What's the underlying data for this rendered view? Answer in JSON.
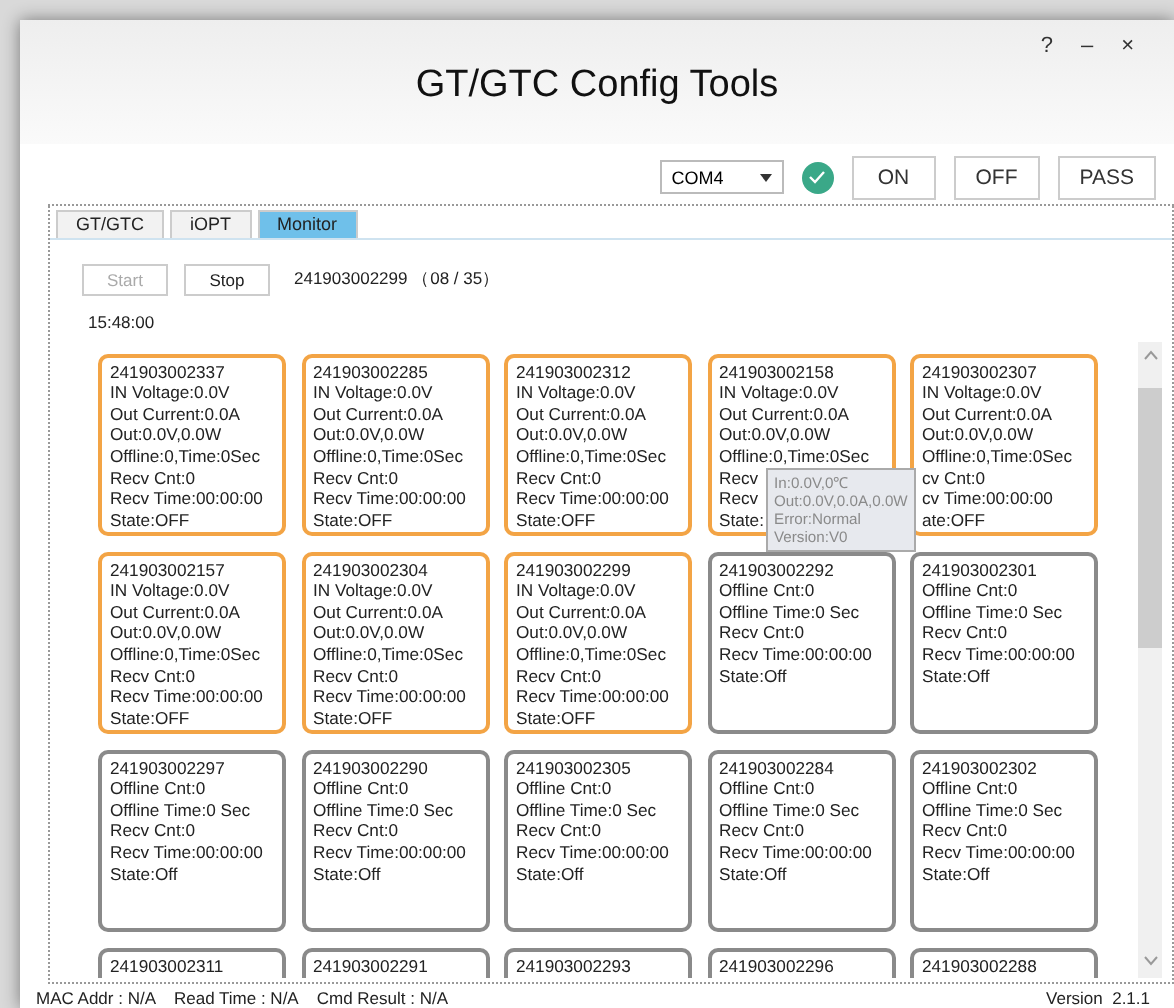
{
  "window": {
    "title": "GT/GTC Config Tools",
    "controls": [
      "?",
      "–",
      "×"
    ]
  },
  "toolbar": {
    "port": "COM4",
    "connected": true,
    "buttons": [
      "ON",
      "OFF",
      "PASS"
    ]
  },
  "tabs": [
    {
      "label": "GT/GTC",
      "selected": false
    },
    {
      "label": "iOPT",
      "selected": false
    },
    {
      "label": "Monitor",
      "selected": true
    }
  ],
  "monitor": {
    "start": {
      "label": "Start",
      "disabled": true
    },
    "stop": {
      "label": "Stop",
      "disabled": false
    },
    "progress": "241903002299 （08 / 35）",
    "time": "15:48:00"
  },
  "cards": [
    {
      "kind": "online",
      "lines": [
        "241903002337",
        "IN Voltage:0.0V",
        "Out Current:0.0A",
        "Out:0.0V,0.0W",
        "Offline:0,Time:0Sec",
        "Recv Cnt:0",
        "Recv Time:00:00:00",
        "State:OFF"
      ]
    },
    {
      "kind": "online",
      "lines": [
        "241903002285",
        "IN Voltage:0.0V",
        "Out Current:0.0A",
        "Out:0.0V,0.0W",
        "Offline:0,Time:0Sec",
        "Recv Cnt:0",
        "Recv Time:00:00:00",
        "State:OFF"
      ]
    },
    {
      "kind": "online",
      "lines": [
        "241903002312",
        "IN Voltage:0.0V",
        "Out Current:0.0A",
        "Out:0.0V,0.0W",
        "Offline:0,Time:0Sec",
        "Recv Cnt:0",
        "Recv Time:00:00:00",
        "State:OFF"
      ]
    },
    {
      "kind": "online",
      "lines": [
        "241903002158",
        "IN Voltage:0.0V",
        "Out Current:0.0A",
        "Out:0.0V,0.0W",
        "Offline:0,Time:0Sec",
        "Recv",
        "Recv",
        "State:"
      ]
    },
    {
      "kind": "online",
      "lines": [
        "241903002307",
        "IN Voltage:0.0V",
        "Out Current:0.0A",
        "Out:0.0V,0.0W",
        "Offline:0,Time:0Sec",
        "cv Cnt:0",
        "cv Time:00:00:00",
        "ate:OFF"
      ]
    },
    {
      "kind": "online",
      "lines": [
        "241903002157",
        "IN Voltage:0.0V",
        "Out Current:0.0A",
        "Out:0.0V,0.0W",
        "Offline:0,Time:0Sec",
        "Recv Cnt:0",
        "Recv Time:00:00:00",
        "State:OFF"
      ]
    },
    {
      "kind": "online",
      "lines": [
        "241903002304",
        "IN Voltage:0.0V",
        "Out Current:0.0A",
        "Out:0.0V,0.0W",
        "Offline:0,Time:0Sec",
        "Recv Cnt:0",
        "Recv Time:00:00:00",
        "State:OFF"
      ]
    },
    {
      "kind": "online",
      "lines": [
        "241903002299",
        "IN Voltage:0.0V",
        "Out Current:0.0A",
        "Out:0.0V,0.0W",
        "Offline:0,Time:0Sec",
        "Recv Cnt:0",
        "Recv Time:00:00:00",
        "State:OFF"
      ]
    },
    {
      "kind": "offline",
      "lines": [
        "241903002292",
        "Offline Cnt:0",
        "Offline Time:0 Sec",
        "Recv Cnt:0",
        "Recv Time:00:00:00",
        "State:Off"
      ]
    },
    {
      "kind": "offline",
      "lines": [
        "241903002301",
        "Offline Cnt:0",
        "Offline Time:0 Sec",
        "Recv Cnt:0",
        "Recv Time:00:00:00",
        "State:Off"
      ]
    },
    {
      "kind": "offline",
      "lines": [
        "241903002297",
        "Offline Cnt:0",
        "Offline Time:0 Sec",
        "Recv Cnt:0",
        "Recv Time:00:00:00",
        "State:Off"
      ]
    },
    {
      "kind": "offline",
      "lines": [
        "241903002290",
        "Offline Cnt:0",
        "Offline Time:0 Sec",
        "Recv Cnt:0",
        "Recv Time:00:00:00",
        "State:Off"
      ]
    },
    {
      "kind": "offline",
      "lines": [
        "241903002305",
        "Offline Cnt:0",
        "Offline Time:0 Sec",
        "Recv Cnt:0",
        "Recv Time:00:00:00",
        "State:Off"
      ]
    },
    {
      "kind": "offline",
      "lines": [
        "241903002284",
        "Offline Cnt:0",
        "Offline Time:0 Sec",
        "Recv Cnt:0",
        "Recv Time:00:00:00",
        "State:Off"
      ]
    },
    {
      "kind": "offline",
      "lines": [
        "241903002302",
        "Offline Cnt:0",
        "Offline Time:0 Sec",
        "Recv Cnt:0",
        "Recv Time:00:00:00",
        "State:Off"
      ]
    },
    {
      "kind": "offline",
      "lines": [
        "241903002311"
      ]
    },
    {
      "kind": "offline",
      "lines": [
        "241903002291"
      ]
    },
    {
      "kind": "offline",
      "lines": [
        "241903002293"
      ]
    },
    {
      "kind": "offline",
      "lines": [
        "241903002296"
      ]
    },
    {
      "kind": "offline",
      "lines": [
        "241903002288"
      ]
    }
  ],
  "tooltip": {
    "lines": [
      "In:0.0V,0℃",
      "Out:0.0V,0.0A,0.0W",
      "Error:Normal",
      "Version:V0"
    ]
  },
  "status_bar": {
    "items": [
      "MAC Addr : N/A",
      "Read Time : N/A",
      "Cmd Result : N/A"
    ],
    "version": "Version  2.1.1"
  }
}
